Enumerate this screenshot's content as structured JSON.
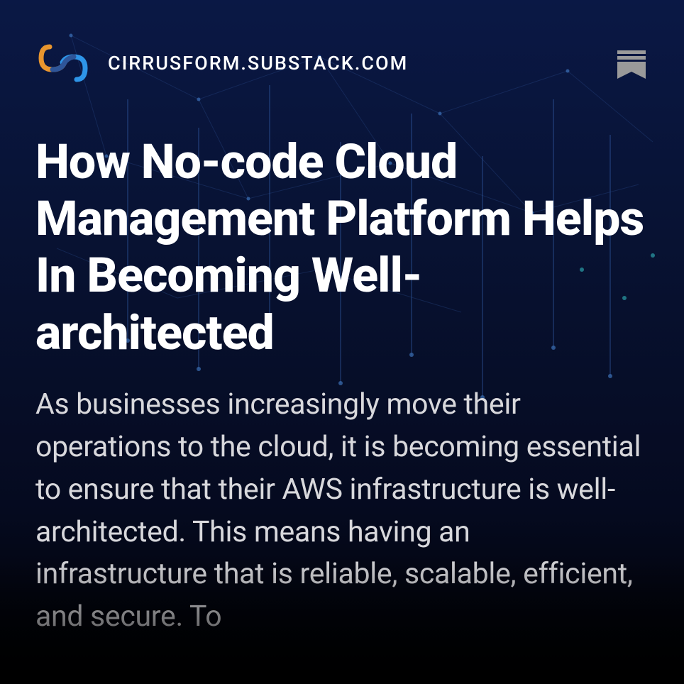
{
  "header": {
    "domain": "CIRRUSFORM.SUBSTACK.COM"
  },
  "article": {
    "title": "How No-code Cloud Management Platform Helps In Becoming Well-architected",
    "body": "As businesses increasingly move their operations to the cloud, it is becoming essential to ensure that their AWS infrastructure is well-architected. This means having an infrastructure that is reliable, scalable, efficient, and secure. To"
  }
}
